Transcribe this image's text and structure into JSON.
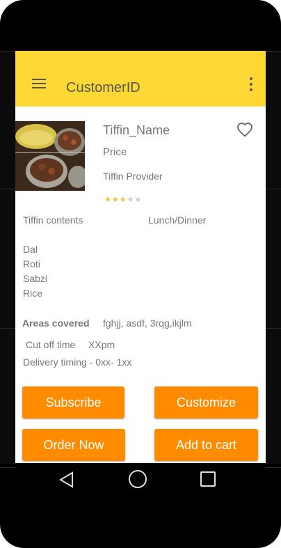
{
  "appbar": {
    "title": "CustomerID",
    "menu_icon": "hamburger-menu-icon",
    "overflow_icon": "more-vert-icon",
    "color": "#fdd835"
  },
  "tiffin": {
    "name": "Tiffin_Name",
    "price": "Price",
    "provider": "Tiffin Provider",
    "rating": 3,
    "rating_max": 5,
    "favorite_icon": "heart-outline-icon"
  },
  "details": {
    "contents_label": "Tiffin contents",
    "meal_type": "Lunch/Dinner",
    "items": [
      "Dal",
      "Roti",
      "Sabzi",
      "Rice"
    ],
    "areas_label": "Areas covered",
    "areas_value": "fghjj, asdf, 3rqg,ikjlm",
    "cutoff_label": "Cut off time",
    "cutoff_value": "XXpm",
    "delivery": "Delivery timing - 0xx- 1xx"
  },
  "buttons": {
    "subscribe": "Subscribe",
    "customize": "Customize",
    "order_now": "Order Now",
    "add_to_cart": "Add to cart",
    "color": "#ff8c00"
  },
  "navbar": {
    "back_icon": "back-triangle-icon",
    "home_icon": "home-circle-icon",
    "recents_icon": "recents-square-icon"
  }
}
